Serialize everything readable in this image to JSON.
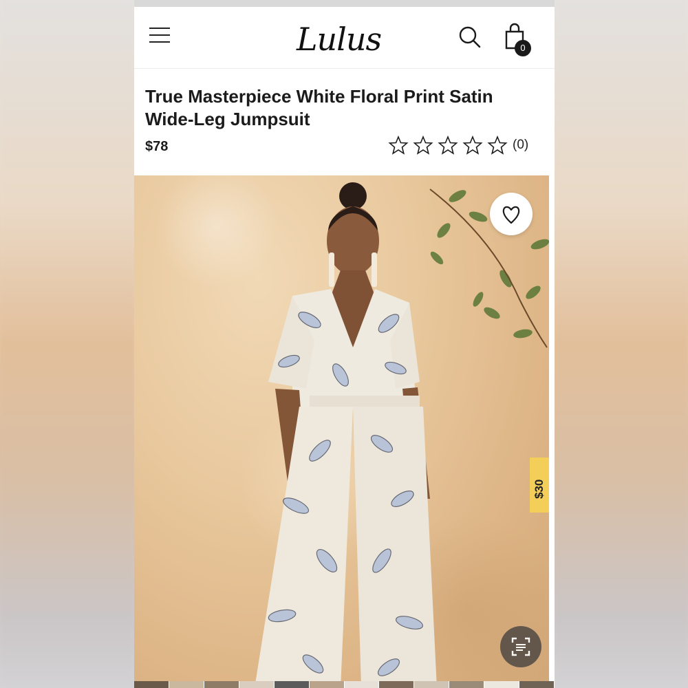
{
  "nav": {
    "logo": "Lulus",
    "cart_count": "0"
  },
  "product": {
    "title": "True Masterpiece White Floral Print Satin Wide-Leg Jumpsuit",
    "price": "$78",
    "rating_count": "(0)",
    "stars": 0
  },
  "promo": {
    "label": "$30"
  },
  "icons": {
    "menu": "hamburger-menu-icon",
    "search": "search-icon",
    "bag": "shopping-bag-icon",
    "wishlist": "heart-icon",
    "lens": "visual-search-icon",
    "star": "star-outline-icon"
  },
  "colors": {
    "text": "#1b1b1b",
    "badge": "#1a1a1a",
    "promo": "#f3cf5a"
  }
}
